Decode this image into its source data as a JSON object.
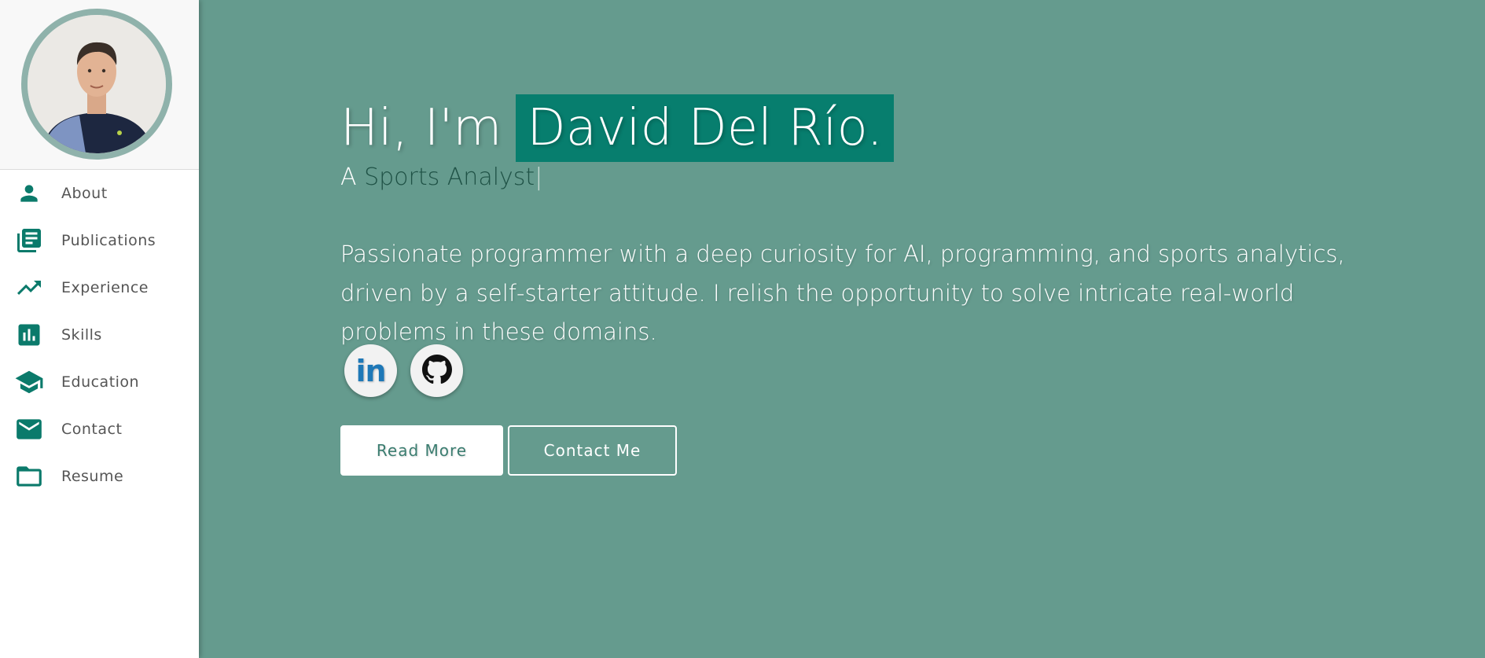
{
  "sidebar": {
    "avatar_alt": "Profile photo",
    "items": [
      {
        "label": "About",
        "icon": "person-icon"
      },
      {
        "label": "Publications",
        "icon": "publications-icon"
      },
      {
        "label": "Experience",
        "icon": "trending-up-icon"
      },
      {
        "label": "Skills",
        "icon": "bar-chart-icon"
      },
      {
        "label": "Education",
        "icon": "graduation-cap-icon"
      },
      {
        "label": "Contact",
        "icon": "mail-icon"
      },
      {
        "label": "Resume",
        "icon": "folder-icon"
      }
    ]
  },
  "hero": {
    "greeting": "Hi, I'm",
    "name": "David Del Río.",
    "role_prefix": "A",
    "role_typed": "Sports Analyst",
    "role_cursor": "|",
    "bio": "Passionate programmer with a deep curiosity for AI, programming, and sports analytics, driven by a self-starter attitude. I relish the opportunity to solve intricate real-world problems in these domains.",
    "socials": [
      {
        "name": "LinkedIn",
        "label": "in",
        "icon": "linkedin-icon"
      },
      {
        "name": "GitHub",
        "icon": "github-icon"
      }
    ],
    "buttons": {
      "primary": "Read More",
      "secondary": "Contact Me"
    }
  },
  "colors": {
    "background": "#659b8e",
    "accent": "#077e6e",
    "icon": "#0b7a6b",
    "avatar_border": "#8fb2ab"
  }
}
